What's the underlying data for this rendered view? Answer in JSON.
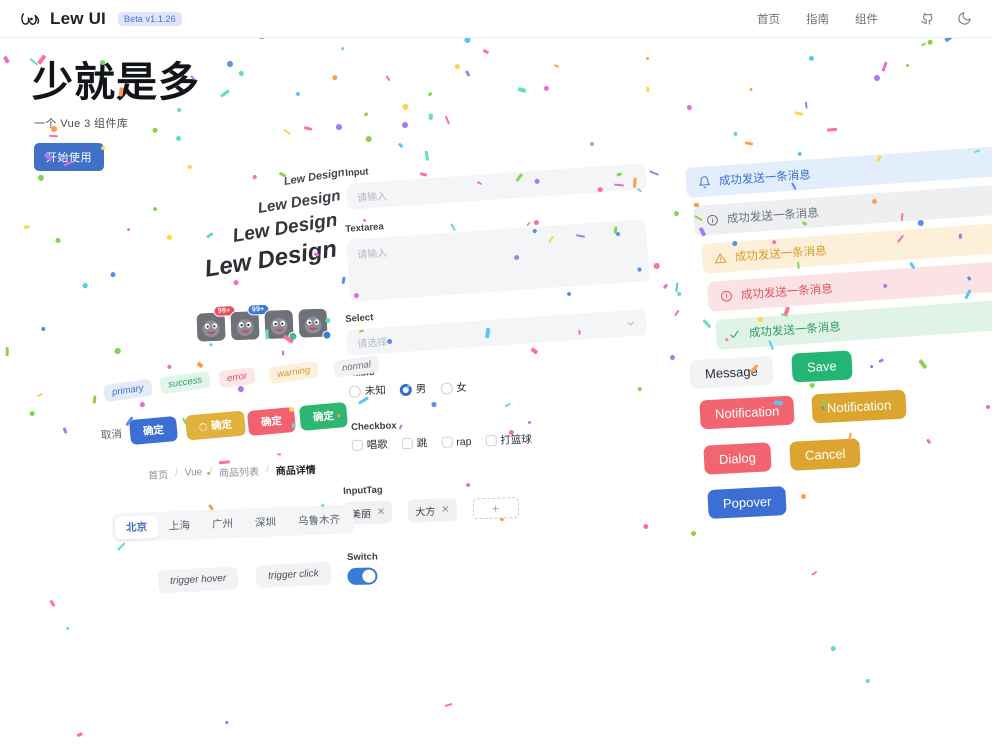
{
  "header": {
    "brand": "Lew UI",
    "logo_icon": "lew-logo-icon",
    "badge": "Beta v1.1.26",
    "nav": [
      {
        "label": "首页"
      },
      {
        "label": "指南"
      },
      {
        "label": "组件"
      }
    ],
    "github_icon": "github-icon",
    "theme_icon": "moon-icon"
  },
  "hero": {
    "title": "少就是多",
    "subtitle": "一个 Vue 3 组件库",
    "cta": "开始使用"
  },
  "lew_design": {
    "items": [
      {
        "text": "Lew Design"
      },
      {
        "text": "Lew Design"
      },
      {
        "text": "Lew Design"
      },
      {
        "text": "Lew Design"
      }
    ]
  },
  "avatars": [
    {
      "badge": "99+",
      "badge_color": "#ef4f5a",
      "dot": ""
    },
    {
      "badge": "99+",
      "badge_color": "#3b7bd8",
      "dot": ""
    },
    {
      "badge": "",
      "dot": "#3fc07a"
    },
    {
      "badge": "",
      "dot": "#3b7bd8"
    }
  ],
  "tags": [
    {
      "label": "primary",
      "color": "#3b6fd4",
      "bg": "#e3ebfb"
    },
    {
      "label": "success",
      "color": "#2f9e63",
      "bg": "#e2f5ea"
    },
    {
      "label": "error",
      "color": "#e0525f",
      "bg": "#fde6e8"
    },
    {
      "label": "warning",
      "color": "#d99b2a",
      "bg": "#fdf1dd"
    },
    {
      "label": "normal",
      "color": "#6b717a",
      "bg": "#f1f2f4"
    }
  ],
  "buttons_row": [
    {
      "label": "取消",
      "variant": "plain"
    },
    {
      "label": "确定",
      "bg": "#3b6fd4"
    },
    {
      "label": "确定",
      "bg": "#e0b13c",
      "loading": true
    },
    {
      "label": "确定",
      "bg": "#f1616f"
    },
    {
      "label": "确定",
      "bg": "#2eb673"
    }
  ],
  "breadcrumb": {
    "items": [
      "首页",
      "Vue",
      "商品列表",
      "商品详情"
    ],
    "separator": "/"
  },
  "tabs": {
    "items": [
      "北京",
      "上海",
      "广州",
      "深圳",
      "乌鲁木齐"
    ],
    "active": "北京"
  },
  "trigger_buttons": [
    {
      "label": "trigger hover"
    },
    {
      "label": "trigger click"
    }
  ],
  "forms": {
    "input": {
      "label": "Input",
      "placeholder": "请输入",
      "value": ""
    },
    "textarea": {
      "label": "Textarea",
      "placeholder": "请输入",
      "value": ""
    },
    "select": {
      "label": "Select",
      "placeholder": "请选择",
      "value": "",
      "chevron_icon": "chevron-down-icon"
    },
    "radio": {
      "label": "Radio",
      "options": [
        {
          "label": "未知",
          "checked": false
        },
        {
          "label": "男",
          "checked": true
        },
        {
          "label": "女",
          "checked": false
        }
      ]
    },
    "checkbox": {
      "label": "Checkbox",
      "options": [
        {
          "label": "唱歌",
          "checked": false
        },
        {
          "label": "跳",
          "checked": false
        },
        {
          "label": "rap",
          "checked": false
        },
        {
          "label": "打篮球",
          "checked": false
        }
      ]
    },
    "input_tag": {
      "label": "InputTag",
      "tags": [
        {
          "label": "美丽",
          "remove_icon": "close-icon"
        },
        {
          "label": "大方",
          "remove_icon": "close-icon"
        }
      ],
      "add_label": "+"
    },
    "switch": {
      "label": "Switch",
      "on": true
    }
  },
  "messages": [
    {
      "text": "成功发送一条消息",
      "icon": "bell-icon",
      "bg": "#e3eefc",
      "color": "#3b6fd4"
    },
    {
      "text": "成功发送一条消息",
      "icon": "info-icon",
      "bg": "#eeeff1",
      "color": "#6b717a"
    },
    {
      "text": "成功发送一条消息",
      "icon": "warning-icon",
      "bg": "#fdf0d9",
      "color": "#d99b2a"
    },
    {
      "text": "成功发送一条消息",
      "icon": "error-icon",
      "bg": "#fbe2e5",
      "color": "#e0525f"
    },
    {
      "text": "成功发送一条消息",
      "icon": "check-icon",
      "bg": "#dff3e7",
      "color": "#2f9e63"
    }
  ],
  "action_buttons": [
    {
      "label": "Message",
      "variant": "grey"
    },
    {
      "label": "Save",
      "bg": "#22b573"
    },
    {
      "label": "Notification",
      "bg": "#f2646f"
    },
    {
      "label": "Notification",
      "bg": "#dca52f"
    },
    {
      "label": "Dialog",
      "bg": "#f2646f"
    },
    {
      "label": "Cancel",
      "bg": "#dca52f"
    },
    {
      "label": "Popover",
      "bg": "#3b6fd4"
    }
  ]
}
